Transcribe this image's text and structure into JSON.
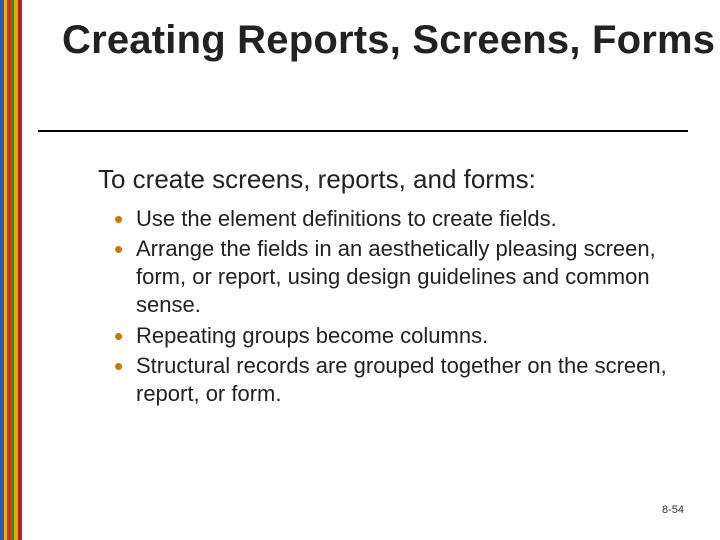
{
  "title": "Creating Reports, Screens, Forms",
  "intro": "To create screens, reports, and forms:",
  "bullets": [
    "Use the element definitions to create fields.",
    "Arrange the fields in an aesthetically pleasing screen, form, or report, using design  guidelines and common sense.",
    "Repeating groups become columns.",
    "Structural records are grouped together on the screen, report, or form."
  ],
  "page_number": "8-54"
}
